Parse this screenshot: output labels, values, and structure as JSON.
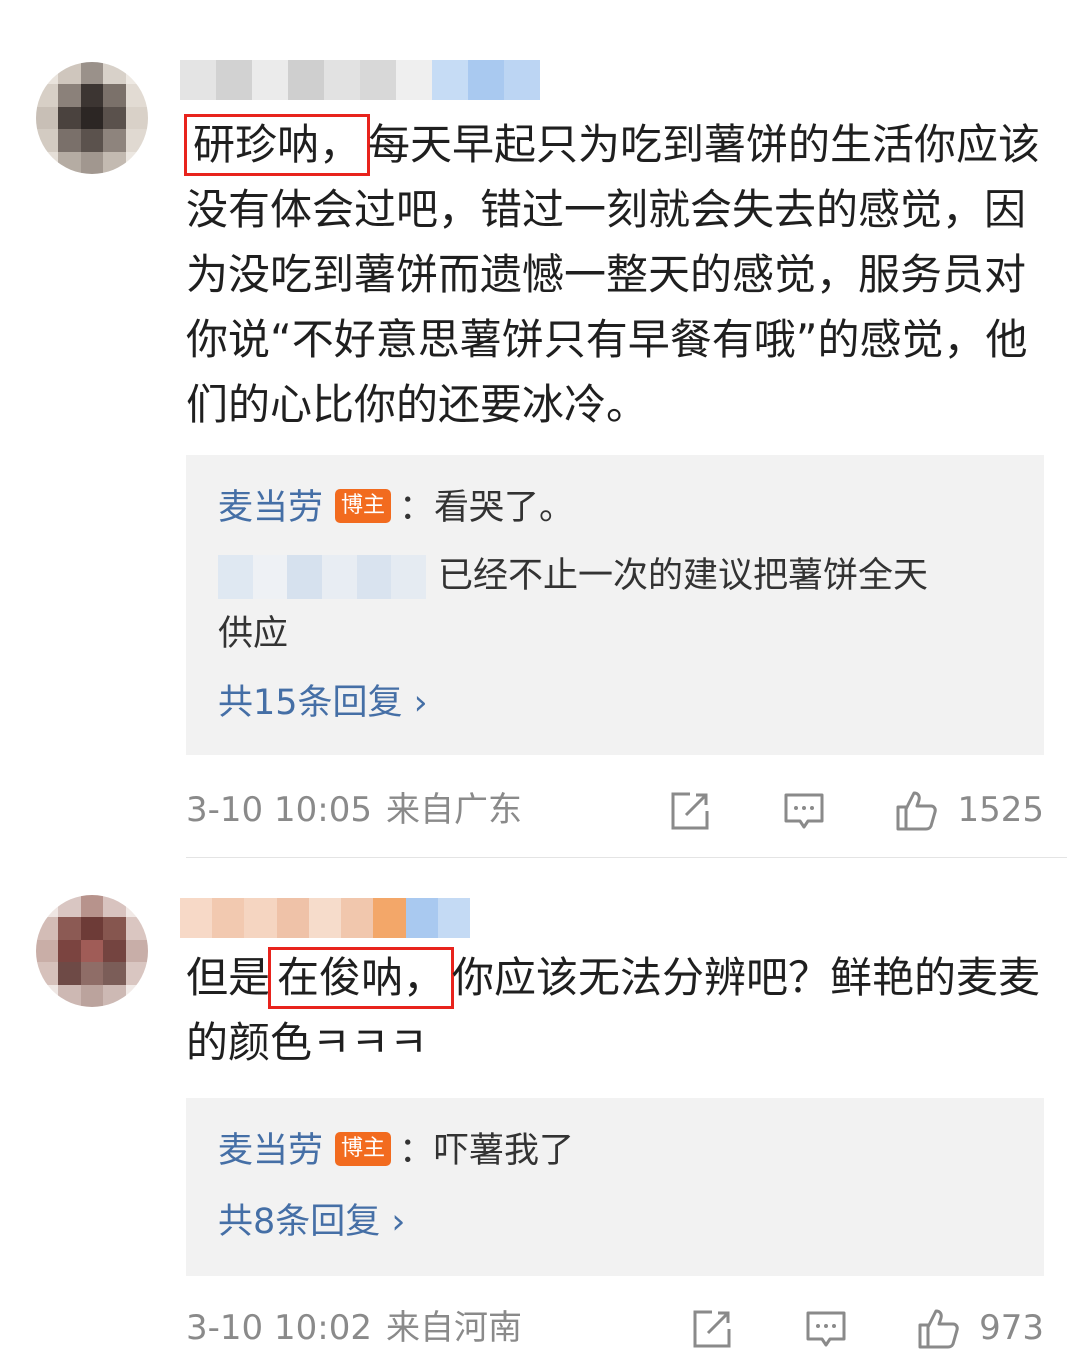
{
  "comments": [
    {
      "highlight": "研珍呐，",
      "text": "每天早起只为吃到薯饼的生活你应该没有体会过吧，错过一刻就会失去的感觉，因为没吃到薯饼而遗憾一整天的感觉，服务员对你说“不好意思薯饼只有早餐有哦”的感觉，他们的心比你的还要冰冷。",
      "replies": [
        {
          "name": "麦当劳",
          "badge": "博主",
          "text": "：看哭了。"
        },
        {
          "text": "已经不止一次的建议把薯饼全天",
          "text2": "供应"
        }
      ],
      "more": "共15条回复 ›",
      "time": "3-10 10:05",
      "source": "来自广东",
      "likes": "1525"
    },
    {
      "prefix": "但是",
      "highlight": "在俊呐，",
      "text": "你应该无法分辨吧？鲜艳的麦麦的颜色ㅋㅋㅋ",
      "replies": [
        {
          "name": "麦当劳",
          "badge": "博主",
          "text": "：吓薯我了"
        }
      ],
      "more": "共8条回复 ›",
      "time": "3-10 10:02",
      "source": "来自河南",
      "likes": "973"
    }
  ],
  "colors": {
    "link": "#456fa6",
    "highlight_border": "#e8231d",
    "badge": "#f26b1f"
  },
  "icons": [
    "share-icon",
    "comment-icon",
    "like-icon"
  ]
}
